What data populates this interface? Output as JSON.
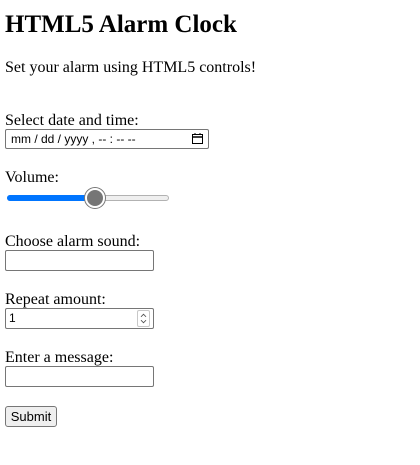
{
  "page": {
    "title": "HTML5 Alarm Clock",
    "intro": "Set your alarm using HTML5 controls!"
  },
  "form": {
    "datetime_label": "Select date and time:",
    "datetime_placeholder": "mm / dd / yyyy ,  -- : --   --",
    "volume_label": "Volume:",
    "volume_value": 0.55,
    "sound_label": "Choose alarm sound:",
    "sound_value": "",
    "repeat_label": "Repeat amount:",
    "repeat_value": "1",
    "message_label": "Enter a message:",
    "message_value": "",
    "submit_label": "Submit"
  },
  "colors": {
    "slider_accent": "#0075ff",
    "slider_thumb": "#767676"
  },
  "icons": {
    "datetime": "calendar-icon",
    "repeat": "spinner-arrows-icon"
  }
}
